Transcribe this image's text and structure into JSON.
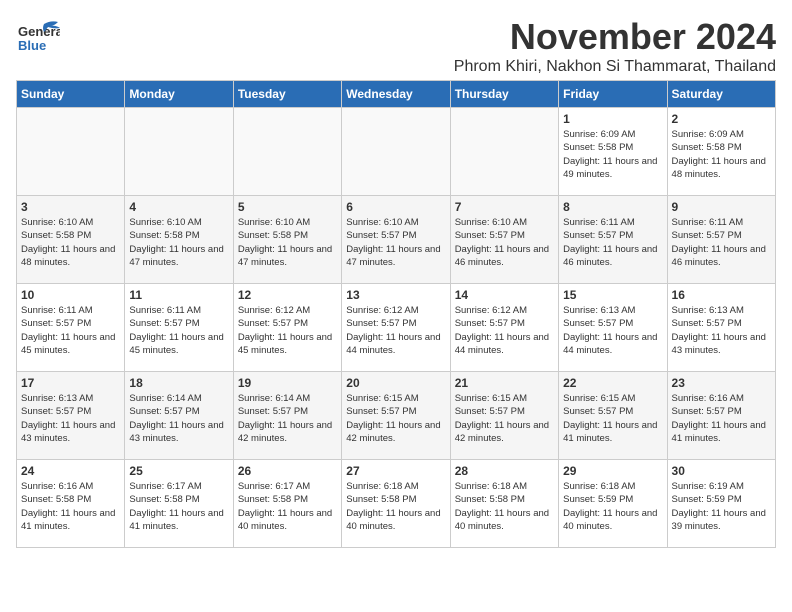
{
  "header": {
    "logo_general": "General",
    "logo_blue": "Blue",
    "month_title": "November 2024",
    "location": "Phrom Khiri, Nakhon Si Thammarat, Thailand"
  },
  "weekdays": [
    "Sunday",
    "Monday",
    "Tuesday",
    "Wednesday",
    "Thursday",
    "Friday",
    "Saturday"
  ],
  "weeks": [
    [
      {
        "day": "",
        "sunrise": "",
        "sunset": "",
        "daylight": ""
      },
      {
        "day": "",
        "sunrise": "",
        "sunset": "",
        "daylight": ""
      },
      {
        "day": "",
        "sunrise": "",
        "sunset": "",
        "daylight": ""
      },
      {
        "day": "",
        "sunrise": "",
        "sunset": "",
        "daylight": ""
      },
      {
        "day": "",
        "sunrise": "",
        "sunset": "",
        "daylight": ""
      },
      {
        "day": "1",
        "sunrise": "Sunrise: 6:09 AM",
        "sunset": "Sunset: 5:58 PM",
        "daylight": "Daylight: 11 hours and 49 minutes."
      },
      {
        "day": "2",
        "sunrise": "Sunrise: 6:09 AM",
        "sunset": "Sunset: 5:58 PM",
        "daylight": "Daylight: 11 hours and 48 minutes."
      }
    ],
    [
      {
        "day": "3",
        "sunrise": "Sunrise: 6:10 AM",
        "sunset": "Sunset: 5:58 PM",
        "daylight": "Daylight: 11 hours and 48 minutes."
      },
      {
        "day": "4",
        "sunrise": "Sunrise: 6:10 AM",
        "sunset": "Sunset: 5:58 PM",
        "daylight": "Daylight: 11 hours and 47 minutes."
      },
      {
        "day": "5",
        "sunrise": "Sunrise: 6:10 AM",
        "sunset": "Sunset: 5:58 PM",
        "daylight": "Daylight: 11 hours and 47 minutes."
      },
      {
        "day": "6",
        "sunrise": "Sunrise: 6:10 AM",
        "sunset": "Sunset: 5:57 PM",
        "daylight": "Daylight: 11 hours and 47 minutes."
      },
      {
        "day": "7",
        "sunrise": "Sunrise: 6:10 AM",
        "sunset": "Sunset: 5:57 PM",
        "daylight": "Daylight: 11 hours and 46 minutes."
      },
      {
        "day": "8",
        "sunrise": "Sunrise: 6:11 AM",
        "sunset": "Sunset: 5:57 PM",
        "daylight": "Daylight: 11 hours and 46 minutes."
      },
      {
        "day": "9",
        "sunrise": "Sunrise: 6:11 AM",
        "sunset": "Sunset: 5:57 PM",
        "daylight": "Daylight: 11 hours and 46 minutes."
      }
    ],
    [
      {
        "day": "10",
        "sunrise": "Sunrise: 6:11 AM",
        "sunset": "Sunset: 5:57 PM",
        "daylight": "Daylight: 11 hours and 45 minutes."
      },
      {
        "day": "11",
        "sunrise": "Sunrise: 6:11 AM",
        "sunset": "Sunset: 5:57 PM",
        "daylight": "Daylight: 11 hours and 45 minutes."
      },
      {
        "day": "12",
        "sunrise": "Sunrise: 6:12 AM",
        "sunset": "Sunset: 5:57 PM",
        "daylight": "Daylight: 11 hours and 45 minutes."
      },
      {
        "day": "13",
        "sunrise": "Sunrise: 6:12 AM",
        "sunset": "Sunset: 5:57 PM",
        "daylight": "Daylight: 11 hours and 44 minutes."
      },
      {
        "day": "14",
        "sunrise": "Sunrise: 6:12 AM",
        "sunset": "Sunset: 5:57 PM",
        "daylight": "Daylight: 11 hours and 44 minutes."
      },
      {
        "day": "15",
        "sunrise": "Sunrise: 6:13 AM",
        "sunset": "Sunset: 5:57 PM",
        "daylight": "Daylight: 11 hours and 44 minutes."
      },
      {
        "day": "16",
        "sunrise": "Sunrise: 6:13 AM",
        "sunset": "Sunset: 5:57 PM",
        "daylight": "Daylight: 11 hours and 43 minutes."
      }
    ],
    [
      {
        "day": "17",
        "sunrise": "Sunrise: 6:13 AM",
        "sunset": "Sunset: 5:57 PM",
        "daylight": "Daylight: 11 hours and 43 minutes."
      },
      {
        "day": "18",
        "sunrise": "Sunrise: 6:14 AM",
        "sunset": "Sunset: 5:57 PM",
        "daylight": "Daylight: 11 hours and 43 minutes."
      },
      {
        "day": "19",
        "sunrise": "Sunrise: 6:14 AM",
        "sunset": "Sunset: 5:57 PM",
        "daylight": "Daylight: 11 hours and 42 minutes."
      },
      {
        "day": "20",
        "sunrise": "Sunrise: 6:15 AM",
        "sunset": "Sunset: 5:57 PM",
        "daylight": "Daylight: 11 hours and 42 minutes."
      },
      {
        "day": "21",
        "sunrise": "Sunrise: 6:15 AM",
        "sunset": "Sunset: 5:57 PM",
        "daylight": "Daylight: 11 hours and 42 minutes."
      },
      {
        "day": "22",
        "sunrise": "Sunrise: 6:15 AM",
        "sunset": "Sunset: 5:57 PM",
        "daylight": "Daylight: 11 hours and 41 minutes."
      },
      {
        "day": "23",
        "sunrise": "Sunrise: 6:16 AM",
        "sunset": "Sunset: 5:57 PM",
        "daylight": "Daylight: 11 hours and 41 minutes."
      }
    ],
    [
      {
        "day": "24",
        "sunrise": "Sunrise: 6:16 AM",
        "sunset": "Sunset: 5:58 PM",
        "daylight": "Daylight: 11 hours and 41 minutes."
      },
      {
        "day": "25",
        "sunrise": "Sunrise: 6:17 AM",
        "sunset": "Sunset: 5:58 PM",
        "daylight": "Daylight: 11 hours and 41 minutes."
      },
      {
        "day": "26",
        "sunrise": "Sunrise: 6:17 AM",
        "sunset": "Sunset: 5:58 PM",
        "daylight": "Daylight: 11 hours and 40 minutes."
      },
      {
        "day": "27",
        "sunrise": "Sunrise: 6:18 AM",
        "sunset": "Sunset: 5:58 PM",
        "daylight": "Daylight: 11 hours and 40 minutes."
      },
      {
        "day": "28",
        "sunrise": "Sunrise: 6:18 AM",
        "sunset": "Sunset: 5:58 PM",
        "daylight": "Daylight: 11 hours and 40 minutes."
      },
      {
        "day": "29",
        "sunrise": "Sunrise: 6:18 AM",
        "sunset": "Sunset: 5:59 PM",
        "daylight": "Daylight: 11 hours and 40 minutes."
      },
      {
        "day": "30",
        "sunrise": "Sunrise: 6:19 AM",
        "sunset": "Sunset: 5:59 PM",
        "daylight": "Daylight: 11 hours and 39 minutes."
      }
    ]
  ]
}
